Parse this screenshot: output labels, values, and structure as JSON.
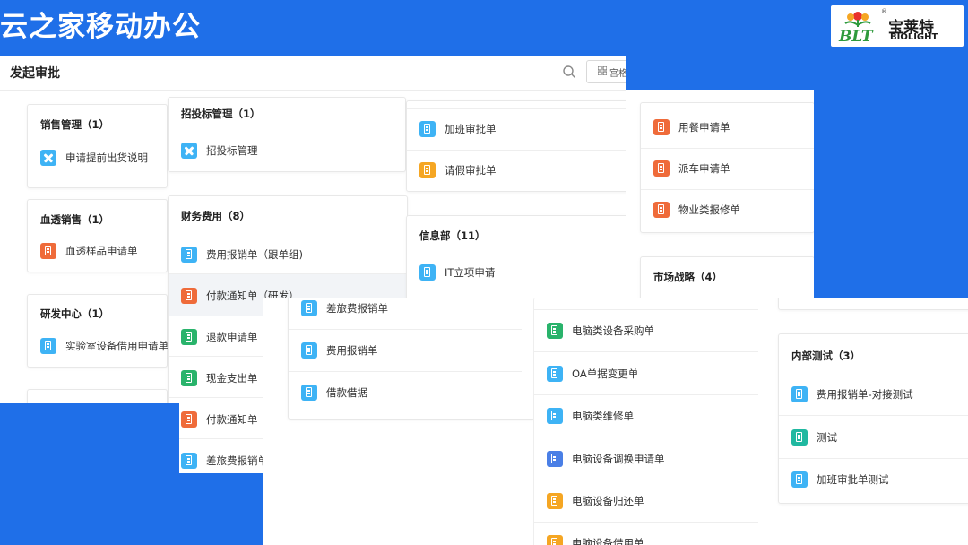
{
  "slide": {
    "title": "云之家移动办公"
  },
  "logo": {
    "brand_cn": "宝莱特",
    "brand_en": "BIOLIGHT",
    "reg": "®",
    "mark_text": "BLT"
  },
  "colors": {
    "blue": "#3eb3f5",
    "orange": "#ef6b3a",
    "green": "#29b36b",
    "amber": "#f5a623",
    "indigo": "#4a7fe6",
    "teal": "#1fb8a0"
  },
  "app": {
    "page_title": "发起审批",
    "view_button": "宫格"
  },
  "cards": {
    "sales": {
      "title": "销售管理（1）",
      "items": [
        "申请提前出货说明"
      ]
    },
    "dialysis": {
      "title": "血透销售（1）",
      "items": [
        "血透样品申请单"
      ]
    },
    "rnd": {
      "title": "研发中心（1）",
      "items": [
        "实验室设备借用申请单"
      ]
    },
    "bidding": {
      "title": "招投标管理（1）",
      "items": [
        "招投标管理"
      ]
    },
    "finance": {
      "title": "财务费用（8）",
      "items": [
        "费用报销单（跟单组)",
        "付款通知单（研发）",
        "退款申请单",
        "现金支出单",
        "付款通知单",
        "差旅费报销单"
      ]
    },
    "hr_top": {
      "items": [
        "加班审批单",
        "请假审批单"
      ]
    },
    "info": {
      "title": "信息部（11）",
      "items": [
        "IT立项申请"
      ]
    },
    "admin": {
      "items": [
        "用餐申请单",
        "派车申请单",
        "物业类报修单"
      ]
    },
    "market": {
      "title": "市场战略（4）"
    },
    "finance_more": {
      "items": [
        "差旅费报销单",
        "费用报销单",
        "借款借据"
      ]
    },
    "info_more": {
      "items": [
        "电脑类设备采购单",
        "OA单据变更单",
        "电脑类维修单",
        "电脑设备调换申请单",
        "电脑设备归还单",
        "电脑设备借用单"
      ]
    },
    "test": {
      "title": "内部测试（3）",
      "items": [
        "费用报销单-对接测试",
        "测试",
        "加班审批单测试"
      ]
    }
  }
}
